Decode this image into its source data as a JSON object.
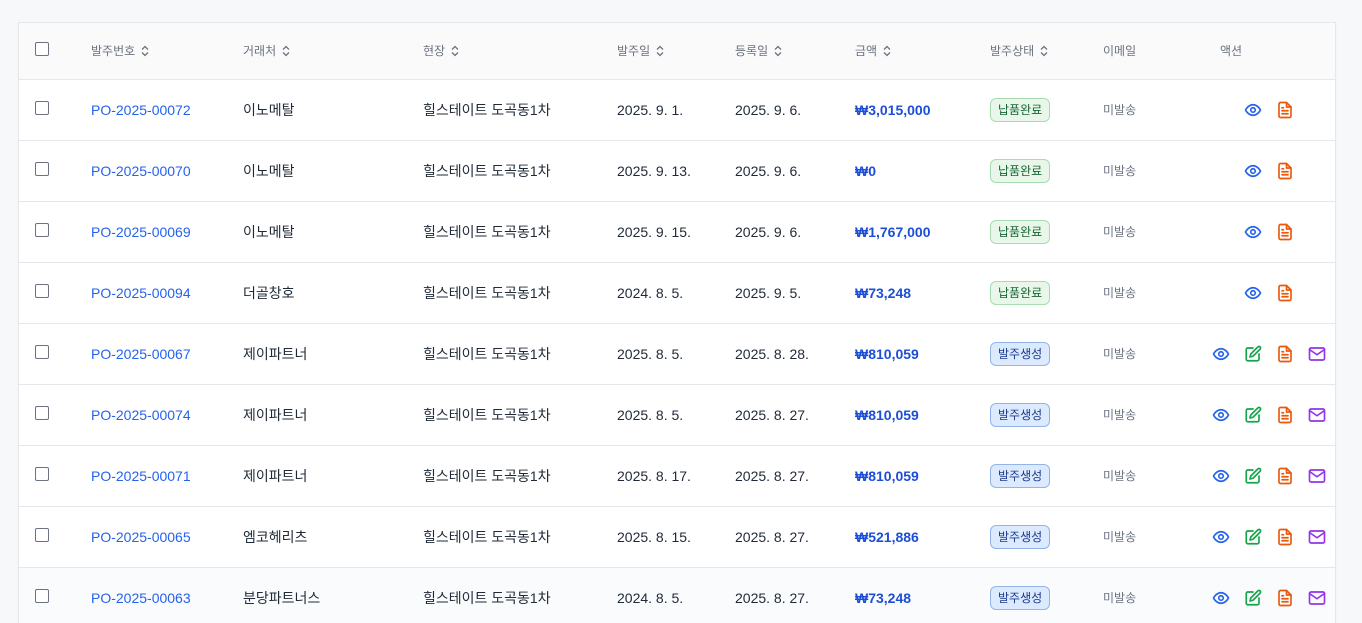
{
  "header": {
    "po_number": "발주번호",
    "vendor": "거래처",
    "site": "현장",
    "order_date": "발주일",
    "reg_date": "등록일",
    "amount": "금액",
    "status": "발주상태",
    "email": "이메일",
    "actions": "액션"
  },
  "rows": [
    {
      "po": "PO-2025-00072",
      "vendor": "이노메탈",
      "site": "힐스테이트 도곡동1차",
      "order_date": "2025. 9. 1.",
      "reg_date": "2025. 9. 6.",
      "amount": "₩3,015,000",
      "status": "납품완료",
      "email": "미발송"
    },
    {
      "po": "PO-2025-00070",
      "vendor": "이노메탈",
      "site": "힐스테이트 도곡동1차",
      "order_date": "2025. 9. 13.",
      "reg_date": "2025. 9. 6.",
      "amount": "₩0",
      "status": "납품완료",
      "email": "미발송"
    },
    {
      "po": "PO-2025-00069",
      "vendor": "이노메탈",
      "site": "힐스테이트 도곡동1차",
      "order_date": "2025. 9. 15.",
      "reg_date": "2025. 9. 6.",
      "amount": "₩1,767,000",
      "status": "납품완료",
      "email": "미발송"
    },
    {
      "po": "PO-2025-00094",
      "vendor": "더골창호",
      "site": "힐스테이트 도곡동1차",
      "order_date": "2024. 8. 5.",
      "reg_date": "2025. 9. 5.",
      "amount": "₩73,248",
      "status": "납품완료",
      "email": "미발송"
    },
    {
      "po": "PO-2025-00067",
      "vendor": "제이파트너",
      "site": "힐스테이트 도곡동1차",
      "order_date": "2025. 8. 5.",
      "reg_date": "2025. 8. 28.",
      "amount": "₩810,059",
      "status": "발주생성",
      "email": "미발송"
    },
    {
      "po": "PO-2025-00074",
      "vendor": "제이파트너",
      "site": "힐스테이트 도곡동1차",
      "order_date": "2025. 8. 5.",
      "reg_date": "2025. 8. 27.",
      "amount": "₩810,059",
      "status": "발주생성",
      "email": "미발송"
    },
    {
      "po": "PO-2025-00071",
      "vendor": "제이파트너",
      "site": "힐스테이트 도곡동1차",
      "order_date": "2025. 8. 17.",
      "reg_date": "2025. 8. 27.",
      "amount": "₩810,059",
      "status": "발주생성",
      "email": "미발송"
    },
    {
      "po": "PO-2025-00065",
      "vendor": "엠코헤리츠",
      "site": "힐스테이트 도곡동1차",
      "order_date": "2025. 8. 15.",
      "reg_date": "2025. 8. 27.",
      "amount": "₩521,886",
      "status": "발주생성",
      "email": "미발송"
    },
    {
      "po": "PO-2025-00063",
      "vendor": "분당파트너스",
      "site": "힐스테이트 도곡동1차",
      "order_date": "2024. 8. 5.",
      "reg_date": "2025. 8. 27.",
      "amount": "₩73,248",
      "status": "발주생성",
      "email": "미발송"
    }
  ],
  "colors": {
    "link": "#2563eb",
    "amount": "#1d4ed8",
    "done_bg": "#e8f7ea",
    "created_bg": "#dbeafe",
    "view_icon": "#2563eb",
    "edit_icon": "#16a34a",
    "pdf_icon": "#ea580c",
    "mail_icon": "#9333ea"
  },
  "icons": {
    "view": "eye-icon",
    "edit": "edit-icon",
    "pdf": "file-pdf-icon",
    "mail": "mail-icon",
    "sort": "sort-icon"
  }
}
